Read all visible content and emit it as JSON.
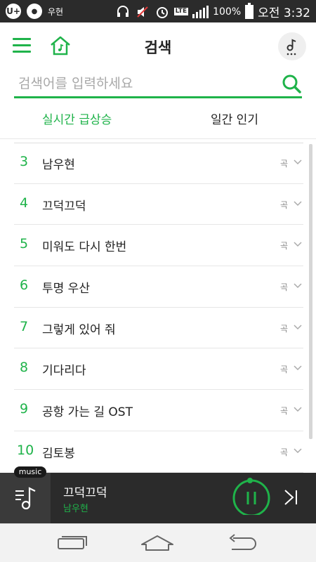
{
  "status_bar": {
    "left_badge": "U+",
    "small_text": "우현",
    "battery": "100%",
    "time": "오전 3:32"
  },
  "header": {
    "title": "검색"
  },
  "search": {
    "placeholder": "검색어를 입력하세요"
  },
  "tabs": [
    {
      "label": "실시간 급상승",
      "active": true
    },
    {
      "label": "일간 인기",
      "active": false
    }
  ],
  "results": [
    {
      "rank": "3",
      "term": "남우현",
      "type": "곡"
    },
    {
      "rank": "4",
      "term": "끄덕끄덕",
      "type": "곡"
    },
    {
      "rank": "5",
      "term": "미워도 다시 한번",
      "type": "곡"
    },
    {
      "rank": "6",
      "term": "투명 우산",
      "type": "곡"
    },
    {
      "rank": "7",
      "term": "그렇게 있어 줘",
      "type": "곡"
    },
    {
      "rank": "8",
      "term": "기다리다",
      "type": "곡"
    },
    {
      "rank": "9",
      "term": "공항 가는 길 OST",
      "type": "곡"
    },
    {
      "rank": "10",
      "term": "김토봉",
      "type": "곡"
    }
  ],
  "player": {
    "tag": "music",
    "title": "끄덕끄덕",
    "artist": "남우현"
  },
  "colors": {
    "accent": "#1fb34a",
    "dark": "#2b2b2b"
  }
}
